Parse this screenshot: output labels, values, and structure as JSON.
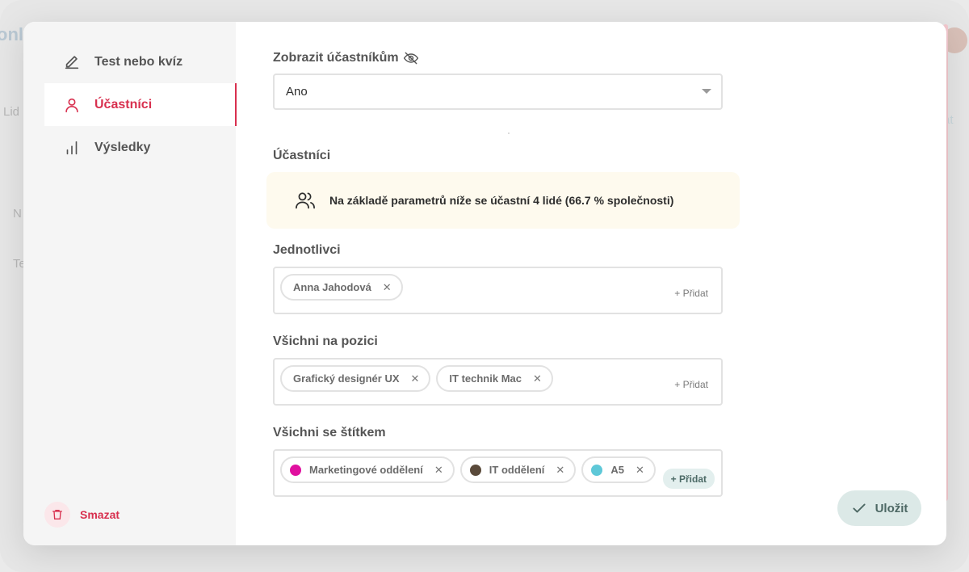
{
  "nav": {
    "items": [
      {
        "label": "Test nebo kvíz",
        "icon": "pencil-icon"
      },
      {
        "label": "Účastníci",
        "icon": "person-icon"
      },
      {
        "label": "Výsledky",
        "icon": "bar-chart-icon"
      }
    ],
    "active_index": 1,
    "delete_label": "Smazat"
  },
  "visibility": {
    "label": "Zobrazit účastníkům",
    "icon": "eye-off-icon",
    "value": "Ano"
  },
  "participants": {
    "label": "Účastníci",
    "info_text": "Na základě parametrů níže se účastní 4 lidé (66.7 % společnosti)",
    "info_icon": "users-icon"
  },
  "individuals": {
    "label": "Jednotlivci",
    "chips": [
      "Anna Jahodová"
    ],
    "add_label": "+ Přidat"
  },
  "positions": {
    "label": "Všichni na pozici",
    "chips": [
      "Grafický designér UX",
      "IT technik Mac"
    ],
    "add_label": "+ Přidat"
  },
  "tags": {
    "label": "Všichni se štítkem",
    "chips": [
      {
        "label": "Marketingové oddělení",
        "color": "#e0109f"
      },
      {
        "label": "IT oddělení",
        "color": "#5a4a3a"
      },
      {
        "label": "A5",
        "color": "#5ec8d8"
      }
    ],
    "add_label": "+ Přidat"
  },
  "save_label": "Uložit",
  "colors": {
    "accent": "#d8304f",
    "save_bg": "#dce9e7",
    "info_bg": "#fefaee"
  }
}
